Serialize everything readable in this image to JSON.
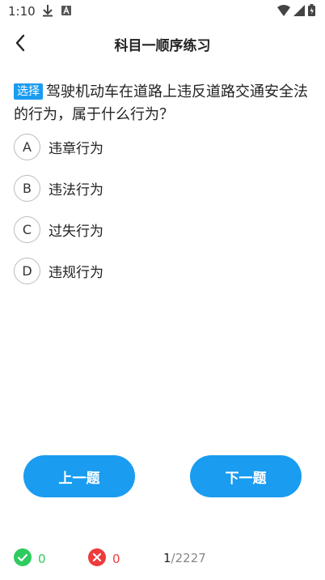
{
  "status": {
    "time": "1:10"
  },
  "header": {
    "title": "科目一顺序练习"
  },
  "question": {
    "tag": "选择",
    "text": "驾驶机动车在道路上违反道路交通安全法的行为，属于什么行为？"
  },
  "options": [
    {
      "letter": "A",
      "text": "违章行为"
    },
    {
      "letter": "B",
      "text": "违法行为"
    },
    {
      "letter": "C",
      "text": "过失行为"
    },
    {
      "letter": "D",
      "text": "违规行为"
    }
  ],
  "buttons": {
    "prev": "上一题",
    "next": "下一题"
  },
  "footer": {
    "correct_count": "0",
    "wrong_count": "0",
    "current": "1",
    "total": "/2227"
  },
  "colors": {
    "accent": "#1a9cf0",
    "correct": "#2ecc5f",
    "wrong": "#ee3b3b"
  }
}
